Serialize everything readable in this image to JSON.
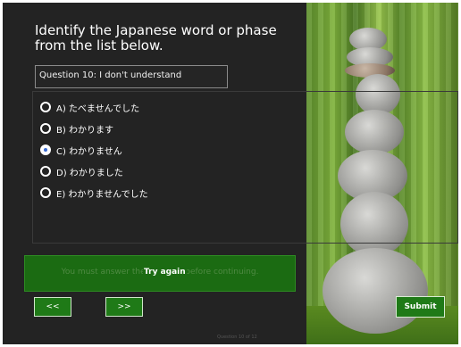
{
  "quiz": {
    "title": "Identify the Japanese  word or phase from the list below.",
    "question": "Question 10: I don't understand",
    "options": [
      {
        "label": "A) たべませんでした",
        "selected": false
      },
      {
        "label": "B) わかります",
        "selected": false
      },
      {
        "label": "C) わかりません",
        "selected": true
      },
      {
        "label": "D) わかりました",
        "selected": false
      },
      {
        "label": "E) わかりませんでした",
        "selected": false
      }
    ],
    "feedback": {
      "message": "You must answer the question before continuing.",
      "try_again": "Try again"
    },
    "nav": {
      "prev_label": "<<",
      "next_label": ">>"
    },
    "submit_label": "Submit",
    "progress": "Question 10 of 12"
  },
  "colors": {
    "background": "#232323",
    "accent_green": "#1f7a17",
    "feedback_green": "#1b6b12",
    "selected_radio": "#3a6bd1"
  }
}
